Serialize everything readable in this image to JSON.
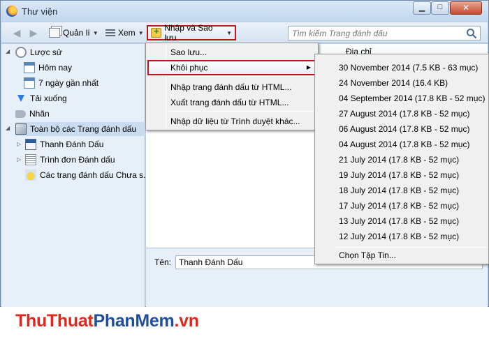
{
  "window": {
    "title": "Thư viện"
  },
  "toolbar": {
    "organize_label": "Quản lí",
    "views_label": "Xem",
    "import_backup_label": "Nhập và Sao lưu",
    "search_placeholder": "Tìm kiếm Trang đánh dấu"
  },
  "sidebar": {
    "items": [
      {
        "label": "Lược sử"
      },
      {
        "label": "Hôm nay"
      },
      {
        "label": "7 ngày gần nhất"
      },
      {
        "label": "Tải xuống"
      },
      {
        "label": "Nhãn"
      },
      {
        "label": "Toàn bộ các Trang đánh dấu"
      },
      {
        "label": "Thanh Đánh Dấu"
      },
      {
        "label": "Trình đơn Đánh dấu"
      },
      {
        "label": "Các trang đánh dấu Chưa s..."
      }
    ]
  },
  "content": {
    "column_address": "Địa chỉ",
    "name_label": "Tên:",
    "name_value": "Thanh Đánh Dấu"
  },
  "import_menu": {
    "backup": "Sao lưu...",
    "restore": "Khôi phục",
    "import_html": "Nhập trang đánh dấu từ HTML...",
    "export_html": "Xuất trang đánh dấu từ HTML...",
    "import_browser": "Nhập dữ liệu từ Trình duyệt khác..."
  },
  "restore_menu": {
    "items": [
      "30 November 2014 (7.5 KB - 63 mục)",
      "24 November 2014 (16.4 KB)",
      "04 September 2014 (17.8 KB - 52 mục)",
      "27 August 2014 (17.8 KB - 52 mục)",
      "06 August 2014 (17.8 KB - 52 mục)",
      "04 August 2014 (17.8 KB - 52 mục)",
      "21 July 2014 (17.8 KB - 52 mục)",
      "19 July 2014 (17.8 KB - 52 mục)",
      "18 July 2014 (17.8 KB - 52 mục)",
      "17 July 2014 (17.8 KB - 52 mục)",
      "13 July 2014 (17.8 KB - 52 mục)",
      "12 July 2014 (17.8 KB - 52 mục)"
    ],
    "choose_file": "Chọn Tập Tin..."
  },
  "watermark": {
    "part1": "ThuThuat",
    "part2": "PhanMem",
    "part3": ".vn"
  }
}
